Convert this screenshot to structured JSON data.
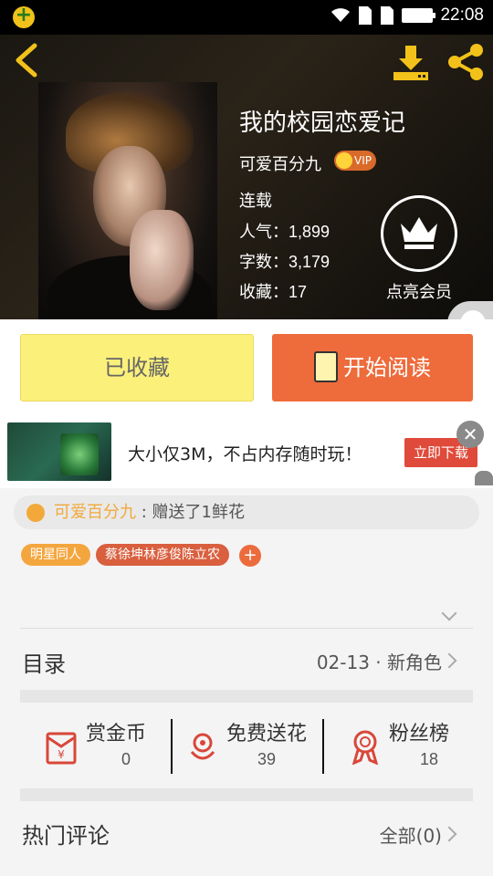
{
  "status_bar": {
    "time": "22:08"
  },
  "book": {
    "title": "我的校园恋爱记",
    "author": "可爱百分九",
    "vip_badge": "VIP",
    "status": "连载",
    "popularity_label": "人气：",
    "popularity": "1,899",
    "words_label": "字数：",
    "words": "3,179",
    "favorites_label": "收藏：",
    "favorites": "17",
    "member_label": "点亮会员"
  },
  "actions": {
    "favorited_label": "已收藏",
    "read_label": "开始阅读"
  },
  "ad": {
    "text": "大小仅3M，不占内存随时玩！",
    "button": "立即下载",
    "close": "✕"
  },
  "gift": {
    "user": "可爱百分九",
    "message": " : 赠送了1鲜花"
  },
  "tags": [
    "明星同人",
    "蔡徐坤林彦俊陈立农"
  ],
  "tag_add": "+",
  "toc": {
    "label": "目录",
    "latest": "02-13 · 新角色"
  },
  "stats": [
    {
      "label": "赏金币",
      "value": "0",
      "icon": "red-envelope-icon"
    },
    {
      "label": "免费送花",
      "value": "39",
      "icon": "flower-icon"
    },
    {
      "label": "粉丝榜",
      "value": "18",
      "icon": "medal-icon"
    }
  ],
  "comments": {
    "label": "热门评论",
    "all": "全部(0)"
  },
  "colors": {
    "accent": "#ee6b3b",
    "favorite": "#fbf07a",
    "highlight": "#f2a93a"
  }
}
